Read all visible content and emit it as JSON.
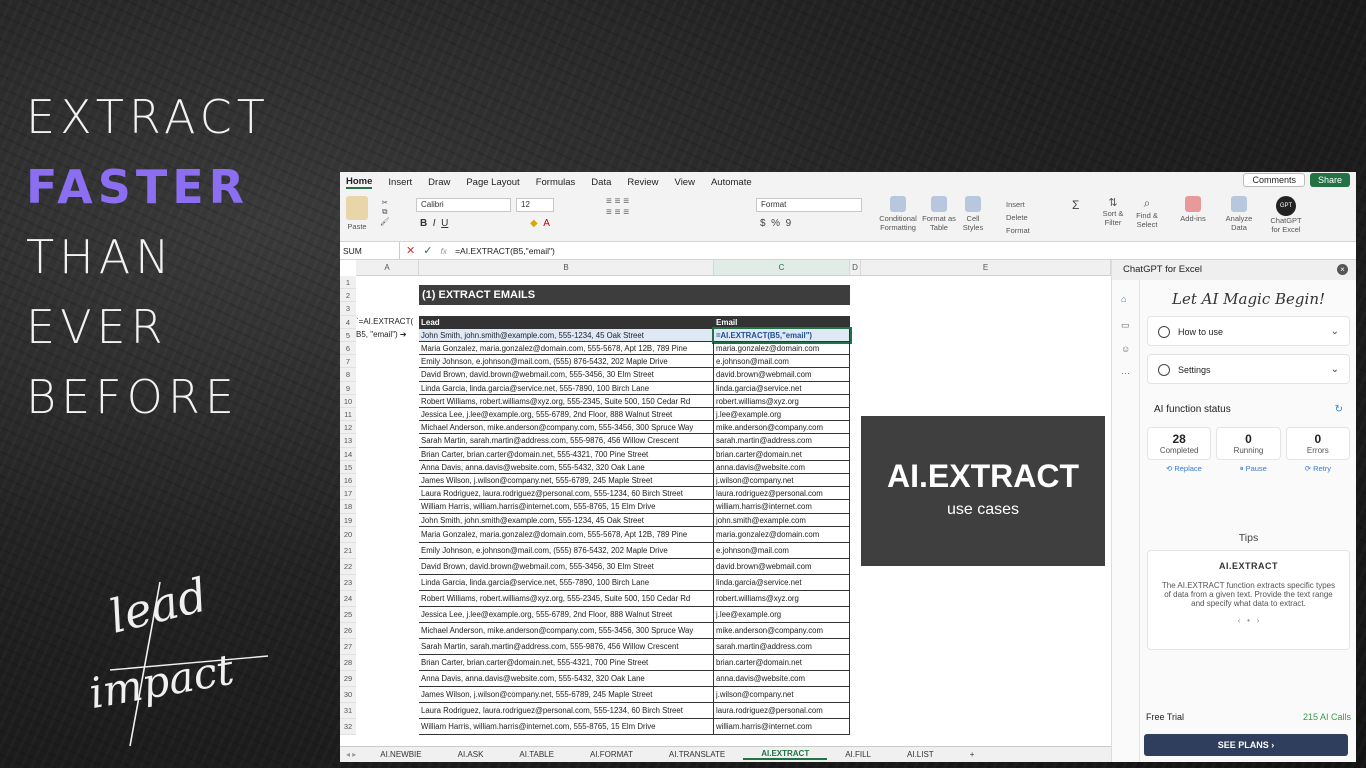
{
  "headline": {
    "line1": "EXTRACT",
    "line2": "FASTER",
    "line3": "THAN",
    "line4": "EVER",
    "line5": "BEFORE"
  },
  "logo": {
    "line1": "lead",
    "line2": "impact"
  },
  "menu": [
    "Home",
    "Insert",
    "Draw",
    "Page Layout",
    "Formulas",
    "Data",
    "Review",
    "View",
    "Automate"
  ],
  "topbar": {
    "comments": "Comments",
    "share": "Share"
  },
  "ribbon": {
    "paste": "Paste",
    "font": "Calibri",
    "size": "12",
    "format": "Format",
    "cond": "Conditional Formatting",
    "fmt_table": "Format as Table",
    "cell_styles": "Cell Styles",
    "insert": "Insert",
    "delete": "Delete",
    "sort": "Sort & Filter",
    "find": "Find & Select",
    "addins": "Add-ins",
    "analyze": "Analyze Data",
    "gpt_badge": "GPT",
    "gpt": "ChatGPT for Excel"
  },
  "formula_bar": {
    "name": "SUM",
    "formula": "=AI.EXTRACT(B5,\"email\")"
  },
  "columns": [
    "A",
    "B",
    "C",
    "D",
    "E"
  ],
  "sheet": {
    "title": "(1) EXTRACT EMAILS",
    "header_lead": "Lead",
    "header_email": "Email",
    "a4": "`=AI.EXTRACT(",
    "a5": "B5, \"email\") ➔",
    "active_formula": "=AI.EXTRACT(B5,\"email\")",
    "rows": [
      [
        "John Smith, john.smith@example.com, 555-1234, 45 Oak Street",
        ""
      ],
      [
        "Maria Gonzalez, maria.gonzalez@domain.com, 555-5678, Apt 12B, 789 Pine",
        "maria.gonzalez@domain.com"
      ],
      [
        "Emily Johnson, e.johnson@mail.com, (555) 876-5432, 202 Maple Drive",
        "e.johnson@mail.com"
      ],
      [
        "David Brown, david.brown@webmail.com, 555-3456, 30 Elm Street",
        "david.brown@webmail.com"
      ],
      [
        "Linda Garcia, linda.garcia@service.net, 555-7890, 100 Birch Lane",
        "linda.garcia@service.net"
      ],
      [
        "Robert Williams, robert.williams@xyz.org, 555-2345, Suite 500, 150 Cedar Rd",
        "robert.williams@xyz.org"
      ],
      [
        "Jessica Lee, j.lee@example.org, 555-6789, 2nd Floor, 888 Walnut Street",
        "j.lee@example.org"
      ],
      [
        "Michael Anderson, mike.anderson@company.com, 555-3456, 300 Spruce Way",
        "mike.anderson@company.com"
      ],
      [
        "Sarah Martin, sarah.martin@address.com, 555-9876, 456 Willow Crescent",
        "sarah.martin@address.com"
      ],
      [
        "Brian Carter, brian.carter@domain.net, 555-4321, 700 Pine Street",
        "brian.carter@domain.net"
      ],
      [
        "Anna Davis, anna.davis@website.com, 555-5432, 320 Oak Lane",
        "anna.davis@website.com"
      ],
      [
        "James Wilson, j.wilson@company.net, 555-6789, 245 Maple Street",
        "j.wilson@company.net"
      ],
      [
        "Laura Rodriguez, laura.rodriguez@personal.com, 555-1234, 60 Birch Street",
        "laura.rodriguez@personal.com"
      ],
      [
        "William Harris, william.harris@internet.com, 555-8765, 15 Elm Drive",
        "william.harris@internet.com"
      ],
      [
        "John Smith, john.smith@example.com, 555-1234, 45 Oak Street",
        "john.smith@example.com"
      ],
      [
        "Maria Gonzalez, maria.gonzalez@domain.com, 555-5678, Apt 12B, 789 Pine",
        "maria.gonzalez@domain.com"
      ],
      [
        "Emily Johnson, e.johnson@mail.com, (555) 876-5432, 202 Maple Drive",
        "e.johnson@mail.com"
      ],
      [
        "David Brown, david.brown@webmail.com, 555-3456, 30 Elm Street",
        "david.brown@webmail.com"
      ],
      [
        "Linda Garcia, linda.garcia@service.net, 555-7890, 100 Birch Lane",
        "linda.garcia@service.net"
      ],
      [
        "Robert Williams, robert.williams@xyz.org, 555-2345, Suite 500, 150 Cedar Rd",
        "robert.williams@xyz.org"
      ],
      [
        "Jessica Lee, j.lee@example.org, 555-6789, 2nd Floor, 888 Walnut Street",
        "j.lee@example.org"
      ],
      [
        "Michael Anderson, mike.anderson@company.com, 555-3456, 300 Spruce Way",
        "mike.anderson@company.com"
      ],
      [
        "Sarah Martin, sarah.martin@address.com, 555-9876, 456 Willow Crescent",
        "sarah.martin@address.com"
      ],
      [
        "Brian Carter, brian.carter@domain.net, 555-4321, 700 Pine Street",
        "brian.carter@domain.net"
      ],
      [
        "Anna Davis, anna.davis@website.com, 555-5432, 320 Oak Lane",
        "anna.davis@website.com"
      ],
      [
        "James Wilson, j.wilson@company.net, 555-6789, 245 Maple Street",
        "j.wilson@company.net"
      ],
      [
        "Laura Rodriguez, laura.rodriguez@personal.com, 555-1234, 60 Birch Street",
        "laura.rodriguez@personal.com"
      ],
      [
        "William Harris, william.harris@internet.com, 555-8765, 15 Elm Drive",
        "william.harris@internet.com"
      ]
    ]
  },
  "card": {
    "title": "AI.EXTRACT",
    "subtitle": "use cases"
  },
  "tabs": [
    "AI.NEWBIE",
    "AI.ASK",
    "AI.TABLE",
    "AI.FORMAT",
    "AI.TRANSLATE",
    "AI.EXTRACT",
    "AI.FILL",
    "AI.LIST",
    "+"
  ],
  "active_tab": "AI.EXTRACT",
  "panel": {
    "title": "ChatGPT for Excel",
    "magic": "Let AI Magic Begin!",
    "how": "How to use",
    "settings": "Settings",
    "status_title": "AI function status",
    "completed_n": "28",
    "completed": "Completed",
    "running_n": "0",
    "running": "Running",
    "errors_n": "0",
    "errors": "Errors",
    "replace": "Replace",
    "pause": "Pause",
    "retry": "Retry",
    "tips": "Tips",
    "tip_title": "AI.EXTRACT",
    "tip_text": "The AI.EXTRACT function extracts specific types of data from a given text. Provide the text range and specify what data to extract.",
    "free_trial": "Free Trial",
    "calls": "215 AI Calls",
    "plans": "SEE PLANS  ›"
  },
  "colors": {
    "accent": "#8b6ff0",
    "excel_green": "#217346",
    "plans": "#2e3e5c"
  }
}
